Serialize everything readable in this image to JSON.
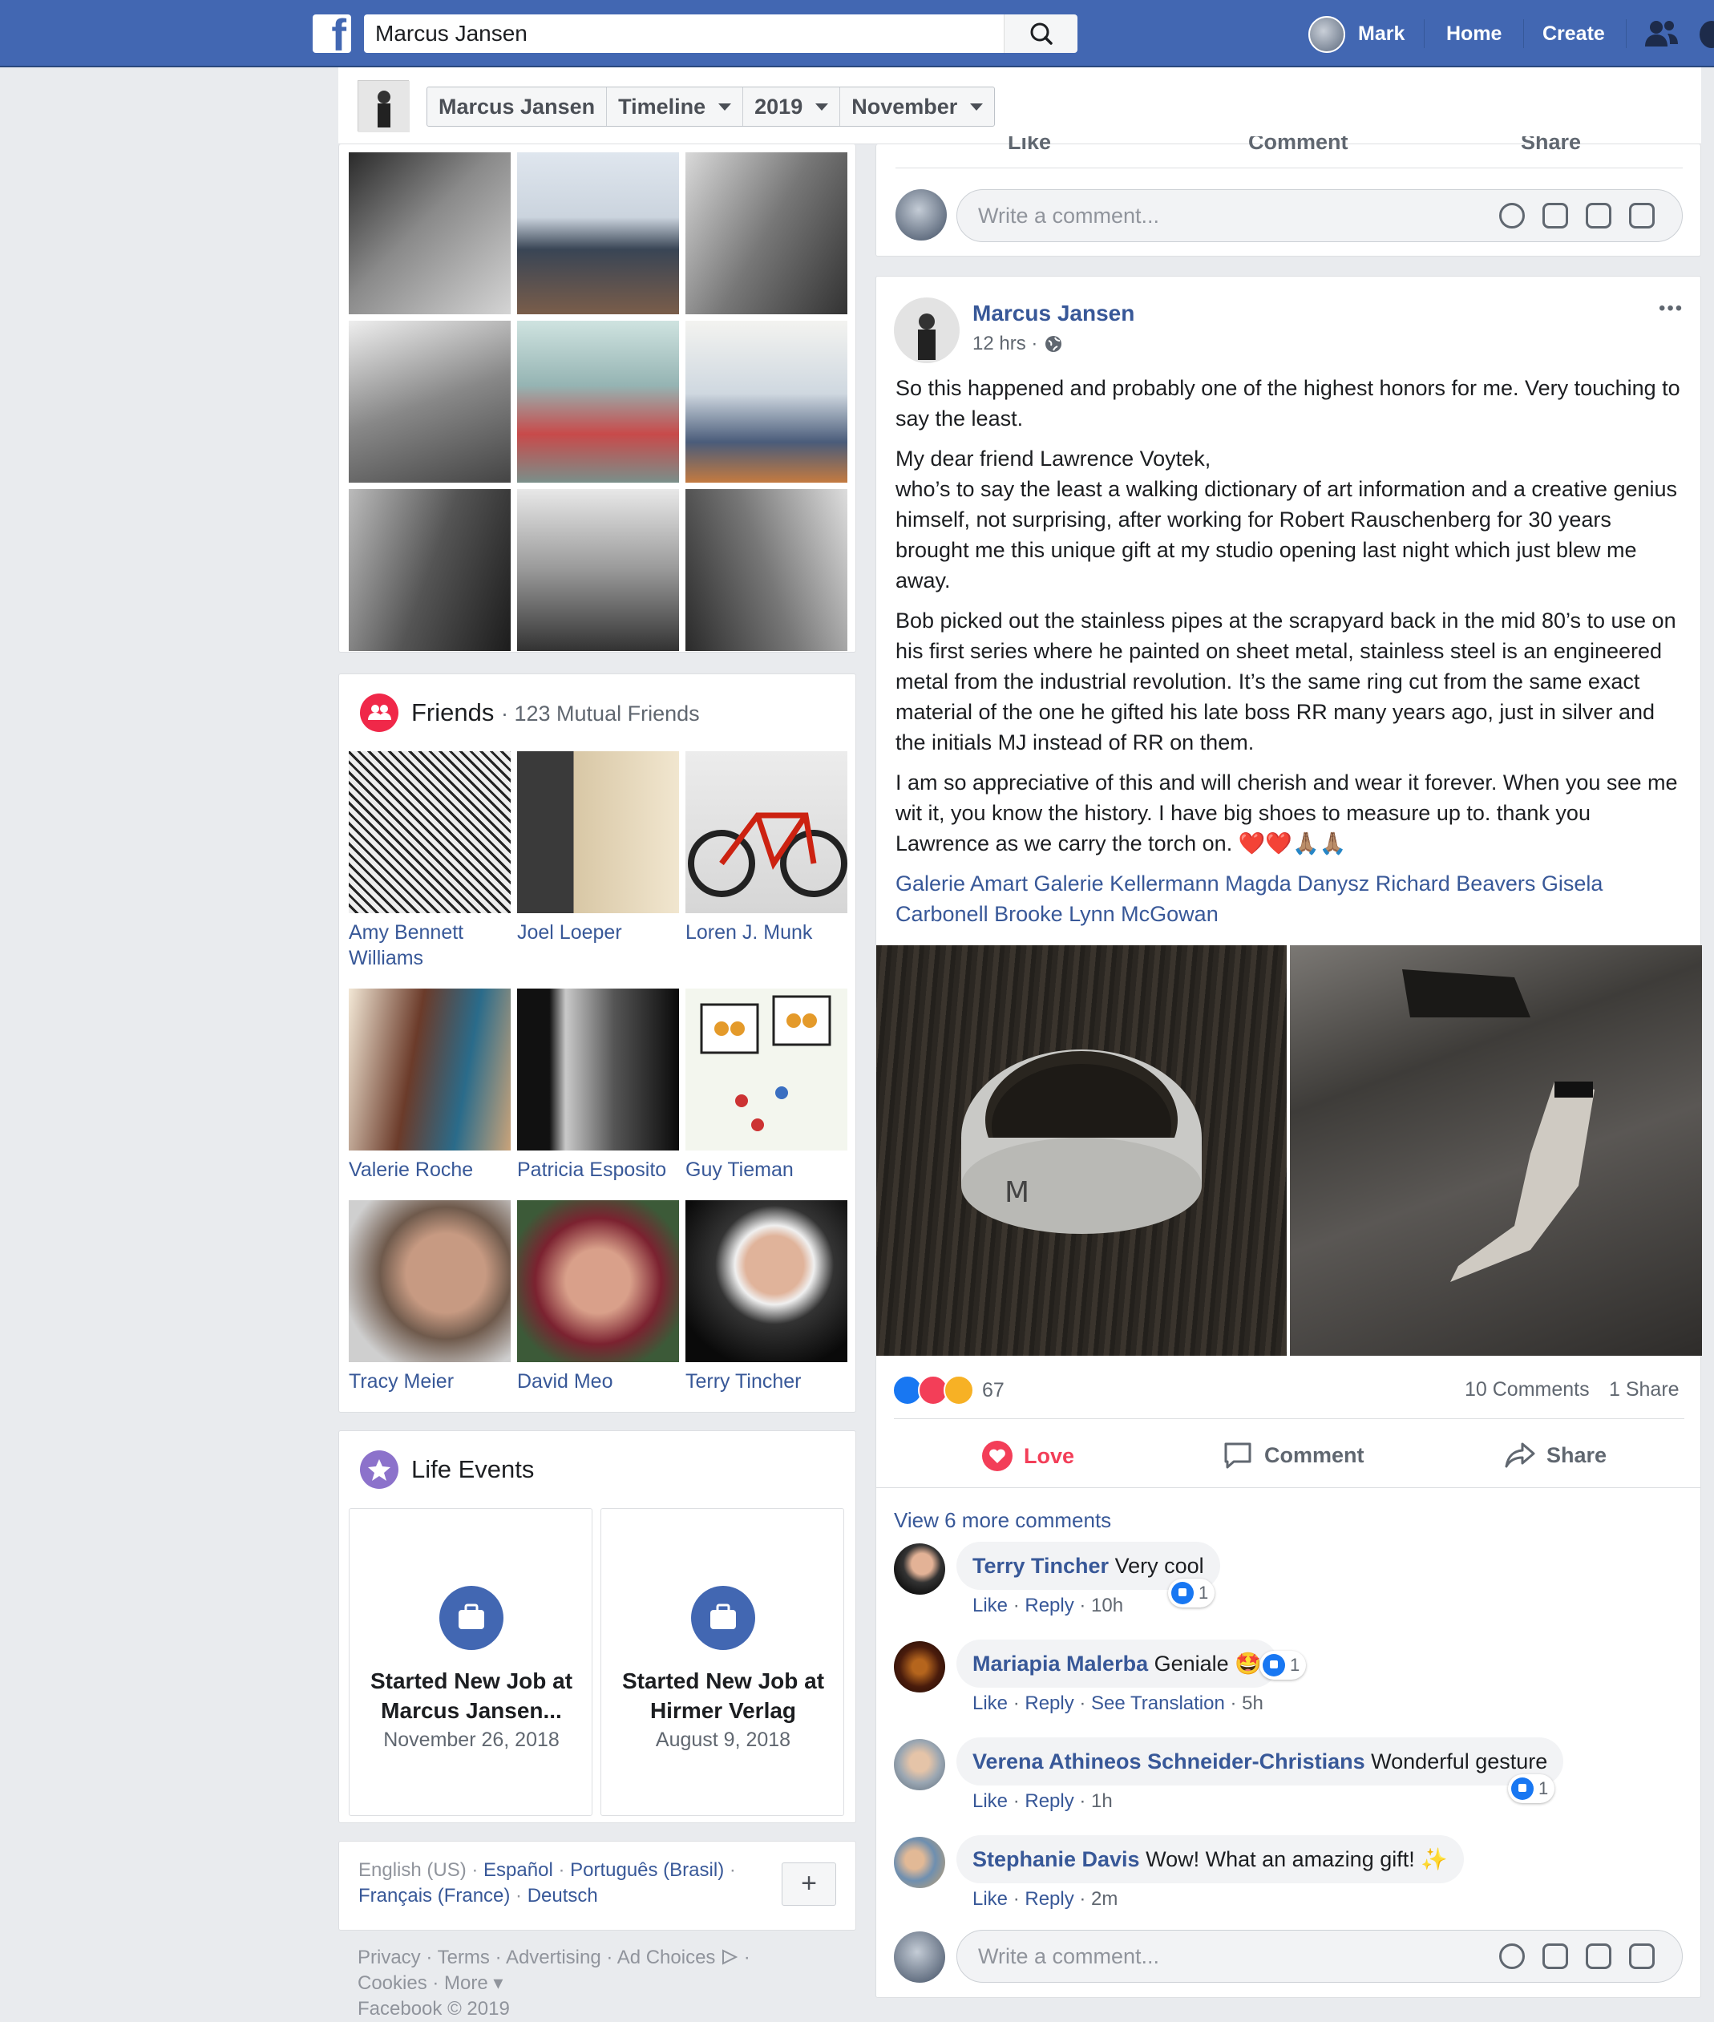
{
  "topbar": {
    "search_value": "Marcus Jansen",
    "user_name": "Mark",
    "home_label": "Home",
    "create_label": "Create"
  },
  "subheader": {
    "crumbs": [
      "Marcus Jansen",
      "Timeline",
      "2019",
      "November"
    ]
  },
  "friends": {
    "title": "Friends",
    "count": "· 123 Mutual Friends",
    "items": [
      {
        "name": "Amy Bennett Williams"
      },
      {
        "name": "Joel Loeper"
      },
      {
        "name": "Loren J. Munk"
      },
      {
        "name": "Valerie Roche"
      },
      {
        "name": "Patricia Esposito"
      },
      {
        "name": "Guy Tieman"
      },
      {
        "name": "Tracy Meier"
      },
      {
        "name": "David Meo"
      },
      {
        "name": "Terry Tincher"
      }
    ]
  },
  "life_events": {
    "title": "Life Events",
    "items": [
      {
        "title": "Started New Job at Marcus Jansen...",
        "date": "November 26, 2018"
      },
      {
        "title": "Started New Job at Hirmer Verlag",
        "date": "August 9, 2018"
      }
    ]
  },
  "languages": {
    "current": "English (US)",
    "links": [
      "Español",
      "Português (Brasil)",
      "Français (France)",
      "Deutsch"
    ],
    "add_label": "+"
  },
  "footer": {
    "links": [
      "Privacy",
      "Terms",
      "Advertising",
      "Ad Choices",
      "Cookies",
      "More"
    ],
    "copyright": "Facebook © 2019"
  },
  "prev_post": {
    "actions": [
      "Like",
      "Comment",
      "Share"
    ],
    "write_placeholder": "Write a comment..."
  },
  "post": {
    "author": "Marcus Jansen",
    "time": "12 hrs ·",
    "more": "•••",
    "paragraphs": [
      "So this happened and probably one of the highest honors for me. Very touching to say the least.",
      "My dear friend Lawrence Voytek,\nwho’s to say the least a walking dictionary of art information and a creative genius himself, not surprising, after working for Robert Rauschenberg for 30 years brought me this unique gift at my studio opening last night which just blew me away.",
      "Bob picked out the stainless pipes at the scrapyard back in the mid 80’s to use on his first series where he painted on sheet metal, stainless steel is an engineered metal from the industrial revolution. It’s the same ring cut from the same exact material of the one he gifted his late boss RR many years ago, just in silver and the initials MJ instead of RR on them.",
      "I am so appreciative of this and will cherish and wear it forever. When you see me wit it, you know the history. I have big shoes to measure up to. thank you Lawrence as we carry the torch on. ❤️❤️🙏🏽🙏🏽"
    ],
    "tags": "Galerie Amart Galerie Kellermann Magda Danysz Richard Beavers Gisela Carbonell Brooke Lynn McGowan",
    "reactions_count": "67",
    "comments_count": "10 Comments",
    "shares_count": "1 Share",
    "actions": {
      "love": "Love",
      "comment": "Comment",
      "share": "Share"
    },
    "view_more": "View 6 more comments",
    "comments": [
      {
        "name": "Terry Tincher",
        "text": "Very cool",
        "meta_links": [
          "Like",
          "Reply"
        ],
        "time": "10h",
        "likes": "1"
      },
      {
        "name": "Mariapia Malerba",
        "text": "Geniale 🤩",
        "meta_links": [
          "Like",
          "Reply",
          "See Translation"
        ],
        "time": "5h",
        "likes": "1"
      },
      {
        "name": "Verena Athineos Schneider-Christians",
        "text": "Wonderful gesture",
        "meta_links": [
          "Like",
          "Reply"
        ],
        "time": "1h",
        "likes": "1"
      },
      {
        "name": "Stephanie Davis",
        "text": "Wow! What an amazing gift! ✨",
        "meta_links": [
          "Like",
          "Reply"
        ],
        "time": "2m",
        "likes": ""
      }
    ],
    "write_placeholder": "Write a comment..."
  }
}
